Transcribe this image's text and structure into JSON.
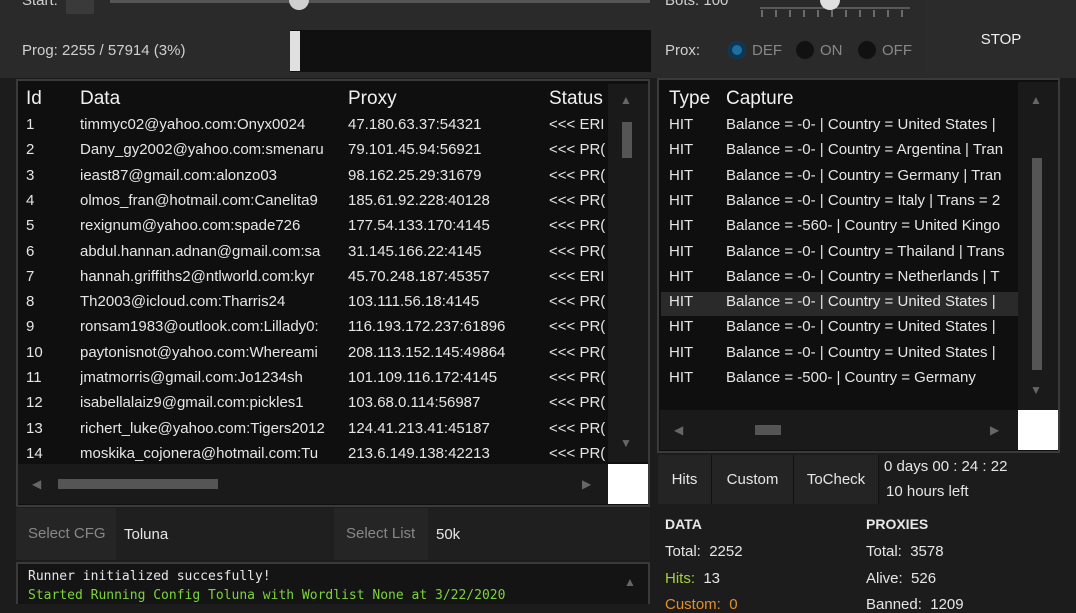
{
  "top": {
    "start_label": "Start:",
    "bots_label": "Bots: 100",
    "stop_label": "STOP",
    "prog_label": "Prog: 2255 / 57914 (3%)",
    "progress_fraction": 0.039,
    "prox_label": "Prox:",
    "prox_options": [
      "DEF",
      "ON",
      "OFF"
    ],
    "prox_selected": "DEF"
  },
  "data_table": {
    "headers": [
      "Id",
      "Data",
      "Proxy",
      "Status"
    ],
    "rows": [
      [
        "1",
        "timmyc02@yahoo.com:Onyx0024",
        "47.180.63.37:54321",
        "<<< ERI"
      ],
      [
        "2",
        "Dany_gy2002@yahoo.com:smenaru",
        "79.101.45.94:56921",
        "<<< PR("
      ],
      [
        "3",
        "ieast87@gmail.com:alonzo03",
        "98.162.25.29:31679",
        "<<< PR("
      ],
      [
        "4",
        "olmos_fran@hotmail.com:Canelita9",
        "185.61.92.228:40128",
        "<<< PR("
      ],
      [
        "5",
        "rexignum@yahoo.com:spade726",
        "177.54.133.170:4145",
        "<<< PR("
      ],
      [
        "6",
        "abdul.hannan.adnan@gmail.com:sa",
        "31.145.166.22:4145",
        "<<< PR("
      ],
      [
        "7",
        "hannah.griffiths2@ntlworld.com:kyr",
        "45.70.248.187:45357",
        "<<< ERI"
      ],
      [
        "8",
        "Th2003@icloud.com:Tharris24",
        "103.111.56.18:4145",
        "<<< PR("
      ],
      [
        "9",
        "ronsam1983@outlook.com:Lillady0:",
        "116.193.172.237:61896",
        "<<< PR("
      ],
      [
        "10",
        "paytonisnot@yahoo.com:Whereami",
        "208.113.152.145:49864",
        "<<< PR("
      ],
      [
        "11",
        "jmatmorris@gmail.com:Jo1234sh",
        "101.109.116.172:4145",
        "<<< PR("
      ],
      [
        "12",
        "isabellalaiz9@gmail.com:pickles1",
        "103.68.0.114:56987",
        "<<< PR("
      ],
      [
        "13",
        "richert_luke@yahoo.com:Tigers2012",
        "124.41.213.41:45187",
        "<<< PR("
      ],
      [
        "14",
        "moskika_cojonera@hotmail.com:Tu",
        "213.6.149.138:42213",
        "<<< PR("
      ]
    ]
  },
  "capture_table": {
    "headers": [
      "Type",
      "Capture"
    ],
    "rows": [
      [
        "HIT",
        "Balance = -0- | Country = United States |"
      ],
      [
        "HIT",
        "Balance = -0- | Country = Argentina | Tran"
      ],
      [
        "HIT",
        "Balance = -0- | Country = Germany | Tran"
      ],
      [
        "HIT",
        "Balance = -0- | Country = Italy | Trans = 2"
      ],
      [
        "HIT",
        "Balance = -560- | Country = United Kingo"
      ],
      [
        "HIT",
        "Balance = -0- | Country = Thailand | Trans"
      ],
      [
        "HIT",
        "Balance = -0- | Country = Netherlands | T"
      ],
      [
        "HIT",
        "Balance = -0- | Country = United States |"
      ],
      [
        "HIT",
        "Balance = -0- | Country = United States |"
      ],
      [
        "HIT",
        "Balance = -0- | Country = United States |"
      ],
      [
        "HIT",
        "Balance = -500- | Country = Germany"
      ]
    ],
    "selected_index": 7
  },
  "tabs": [
    "Hits",
    "Custom",
    "ToCheck"
  ],
  "timer": {
    "elapsed": "0 days 00 : 24 : 22",
    "left": "10 hours left"
  },
  "config": {
    "cfg_label": "Select CFG",
    "cfg_value": "Toluna",
    "list_label": "Select List",
    "list_value": "50k"
  },
  "log": {
    "line1": "Runner initialized succesfully!",
    "line2": "Started Running Config Toluna with Wordlist None at 3/22/2020"
  },
  "stats": {
    "data_title": "DATA",
    "total_label": "Total:",
    "total_value": "2252",
    "hits_label": "Hits:",
    "hits_value": "13",
    "custom_label": "Custom:",
    "custom_value": "0",
    "proxies_title": "PROXIES",
    "ptotal_label": "Total:",
    "ptotal_value": "3578",
    "alive_label": "Alive:",
    "alive_value": "526",
    "banned_label": "Banned:",
    "banned_value": "1209"
  },
  "colors": {
    "hits": "#a4d13a",
    "custom": "#e0902a",
    "log_green": "#7cd33a",
    "radio_active": "#1e6fa0"
  }
}
